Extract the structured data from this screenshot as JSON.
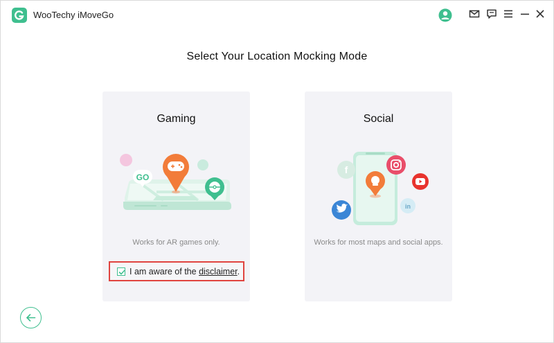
{
  "app": {
    "title": "WooTechy iMoveGo",
    "logo_icon": "app-logo-icon",
    "accent_color": "#3fbf8f"
  },
  "titlebar": {
    "icons": [
      "user-account-icon",
      "mail-icon",
      "feedback-icon",
      "menu-icon",
      "minimize-icon",
      "close-icon"
    ]
  },
  "main": {
    "heading": "Select Your Location Mocking Mode",
    "cards": [
      {
        "title": "Gaming",
        "description": "Works for AR games only.",
        "illustration": "gaming-map-illustration",
        "badge": "GO"
      },
      {
        "title": "Social",
        "description": "Works for most maps and social apps.",
        "illustration": "social-phone-illustration",
        "social_icons": [
          "facebook-icon",
          "instagram-icon",
          "youtube-icon",
          "twitter-icon",
          "linkedin-icon"
        ]
      }
    ],
    "disclaimer": {
      "checked": true,
      "text": "I am aware of the ",
      "link": "disclaimer",
      "suffix": ".",
      "highlight_color": "#e0443f"
    }
  },
  "footer": {
    "back_icon": "back-arrow-icon"
  }
}
